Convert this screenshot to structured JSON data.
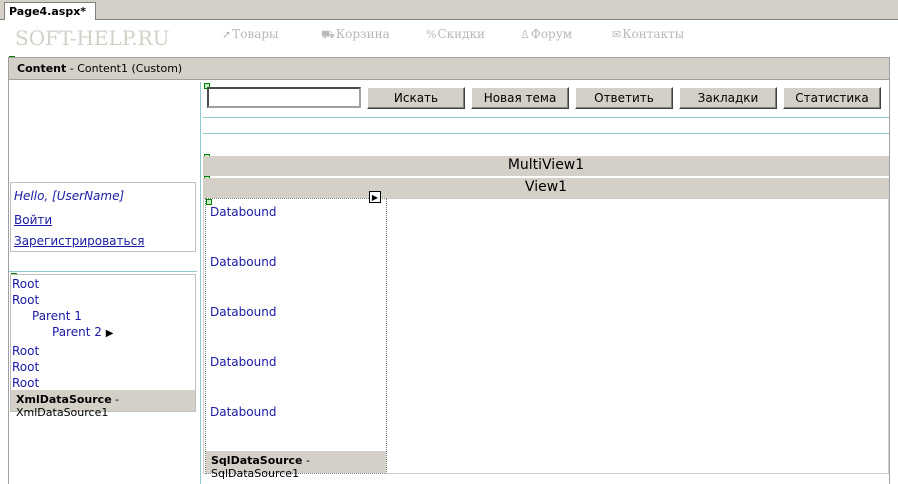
{
  "tab": {
    "title": "Page4.aspx*"
  },
  "header": {
    "logo": "SOFT-HELP.RU",
    "nav": [
      {
        "icon": "arrow-icon",
        "label": "Товары"
      },
      {
        "icon": "cart-icon",
        "label": "Корзина"
      },
      {
        "icon": "percent-icon",
        "label": "Скидки"
      },
      {
        "icon": "people-icon",
        "label": "Форум"
      },
      {
        "icon": "mail-icon",
        "label": "Контакты"
      }
    ]
  },
  "content": {
    "name": "Content",
    "detail": " - Content1 (Custom)"
  },
  "login": {
    "greeting": "Hello, [UserName]",
    "login_link": "Войти",
    "register_link": "Зарегистрироваться"
  },
  "tree": {
    "items": [
      "Root",
      "Root",
      "Parent 1",
      "Parent 2",
      "Root",
      "Root",
      "Root"
    ],
    "datasource_name": "XmlDataSource",
    "datasource_id": " - XmlDataSource1"
  },
  "toolbar": {
    "search_value": "",
    "buttons": [
      "Искать",
      "Новая тема",
      "Ответить",
      "Закладки",
      "Статистика"
    ]
  },
  "multiview": {
    "label": "MultiView1"
  },
  "view": {
    "label": "View1"
  },
  "repeater": {
    "items": [
      "Databound",
      "Databound",
      "Databound",
      "Databound",
      "Databound"
    ],
    "datasource_name": "SqlDataSource",
    "datasource_id": " - SqlDataSource1"
  }
}
